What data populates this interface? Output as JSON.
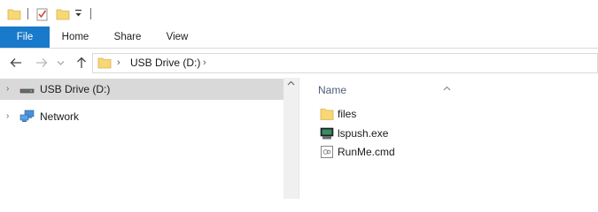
{
  "ribbon": {
    "tabs": [
      {
        "label": "File"
      },
      {
        "label": "Home"
      },
      {
        "label": "Share"
      },
      {
        "label": "View"
      }
    ]
  },
  "address_bar": {
    "location": "USB Drive (D:)"
  },
  "navigation_pane": {
    "items": [
      {
        "label": "USB Drive (D:)",
        "icon": "drive-icon",
        "selected": true
      },
      {
        "label": "Network",
        "icon": "network-icon",
        "selected": false
      }
    ]
  },
  "content": {
    "column_header": "Name",
    "files": [
      {
        "name": "files",
        "icon": "folder-icon"
      },
      {
        "name": "lspush.exe",
        "icon": "exe-icon"
      },
      {
        "name": "RunMe.cmd",
        "icon": "cmd-script-icon"
      }
    ]
  },
  "colors": {
    "file_tab": "#1979ca",
    "selection": "#d9d9d9",
    "folder": "#f8d775",
    "column_header_text": "#4c607a"
  }
}
